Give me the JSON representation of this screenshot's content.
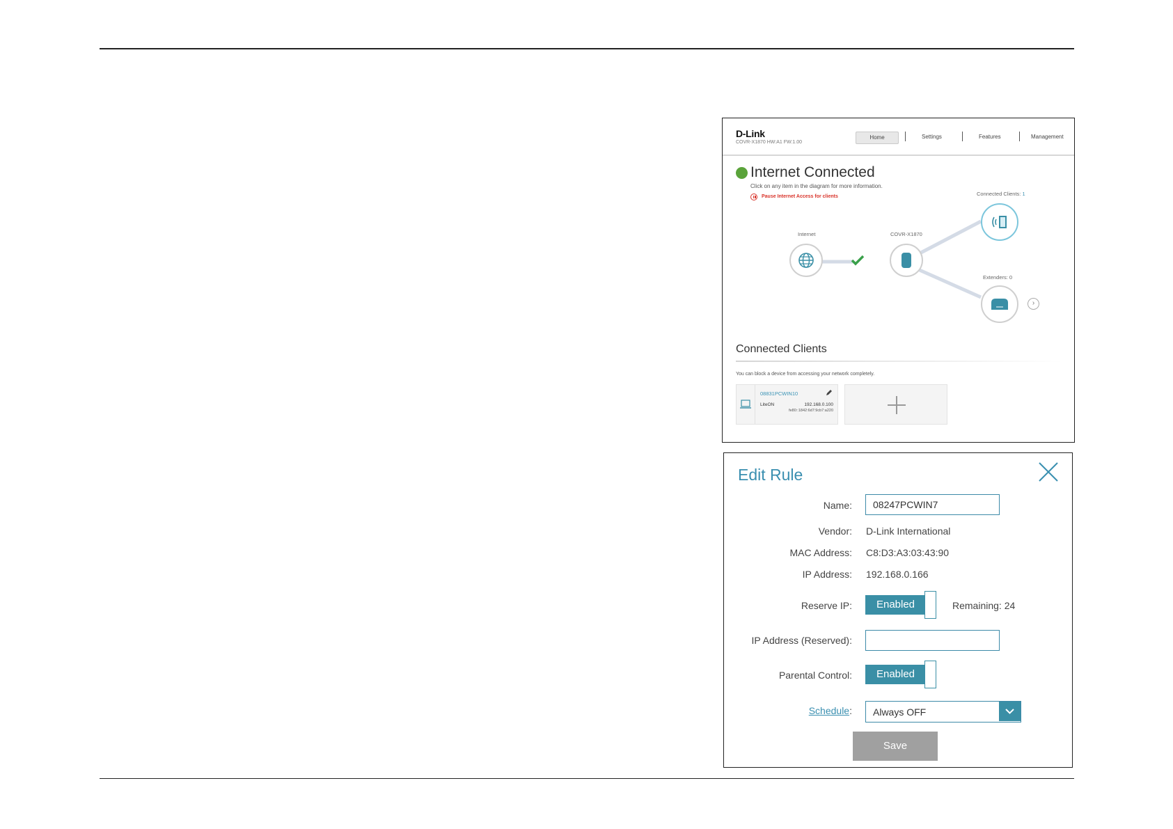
{
  "home": {
    "brand": "D-Link",
    "model": "COVR-X1870 HW:A1 FW:1.00",
    "nav": [
      {
        "label": "Home"
      },
      {
        "label": "Settings"
      },
      {
        "label": "Features"
      },
      {
        "label": "Management"
      }
    ],
    "status": "Internet Connected",
    "status_color": "#5aa33a",
    "hint": "Click on any item in the diagram for more information.",
    "pause_label": "Pause Internet Access for clients",
    "diagram": {
      "internet_label": "Internet",
      "router_label": "COVR-X1870",
      "clients_label": "Connected Clients:",
      "clients_count": "1",
      "extenders_label": "Extenders: 0"
    },
    "connected_clients": {
      "title": "Connected Clients",
      "note": "You can block a device from accessing your network completely.",
      "client": {
        "name": "08831PCWIN10",
        "vendor": "LiteON",
        "ip": "192.168.0.100",
        "ipv6": "fe80::1842:6d7:9cb7:a220"
      }
    }
  },
  "edit_rule": {
    "title": "Edit Rule",
    "name_label": "Name:",
    "name_value": "08247PCWIN7",
    "vendor_label": "Vendor:",
    "vendor_value": "D-Link International",
    "mac_label": "MAC Address:",
    "mac_value": "C8:D3:A3:03:43:90",
    "ip_label": "IP Address:",
    "ip_value": "192.168.0.166",
    "reserve_label": "Reserve IP:",
    "reserve_state": "Enabled",
    "remaining": "Remaining: 24",
    "ip_reserved_label": "IP Address (Reserved):",
    "ip_reserved_value": "",
    "parental_label": "Parental Control:",
    "parental_state": "Enabled",
    "schedule_label": "Schedule",
    "schedule_value": "Always OFF",
    "save_label": "Save",
    "accent_color": "#3a8fa6"
  }
}
